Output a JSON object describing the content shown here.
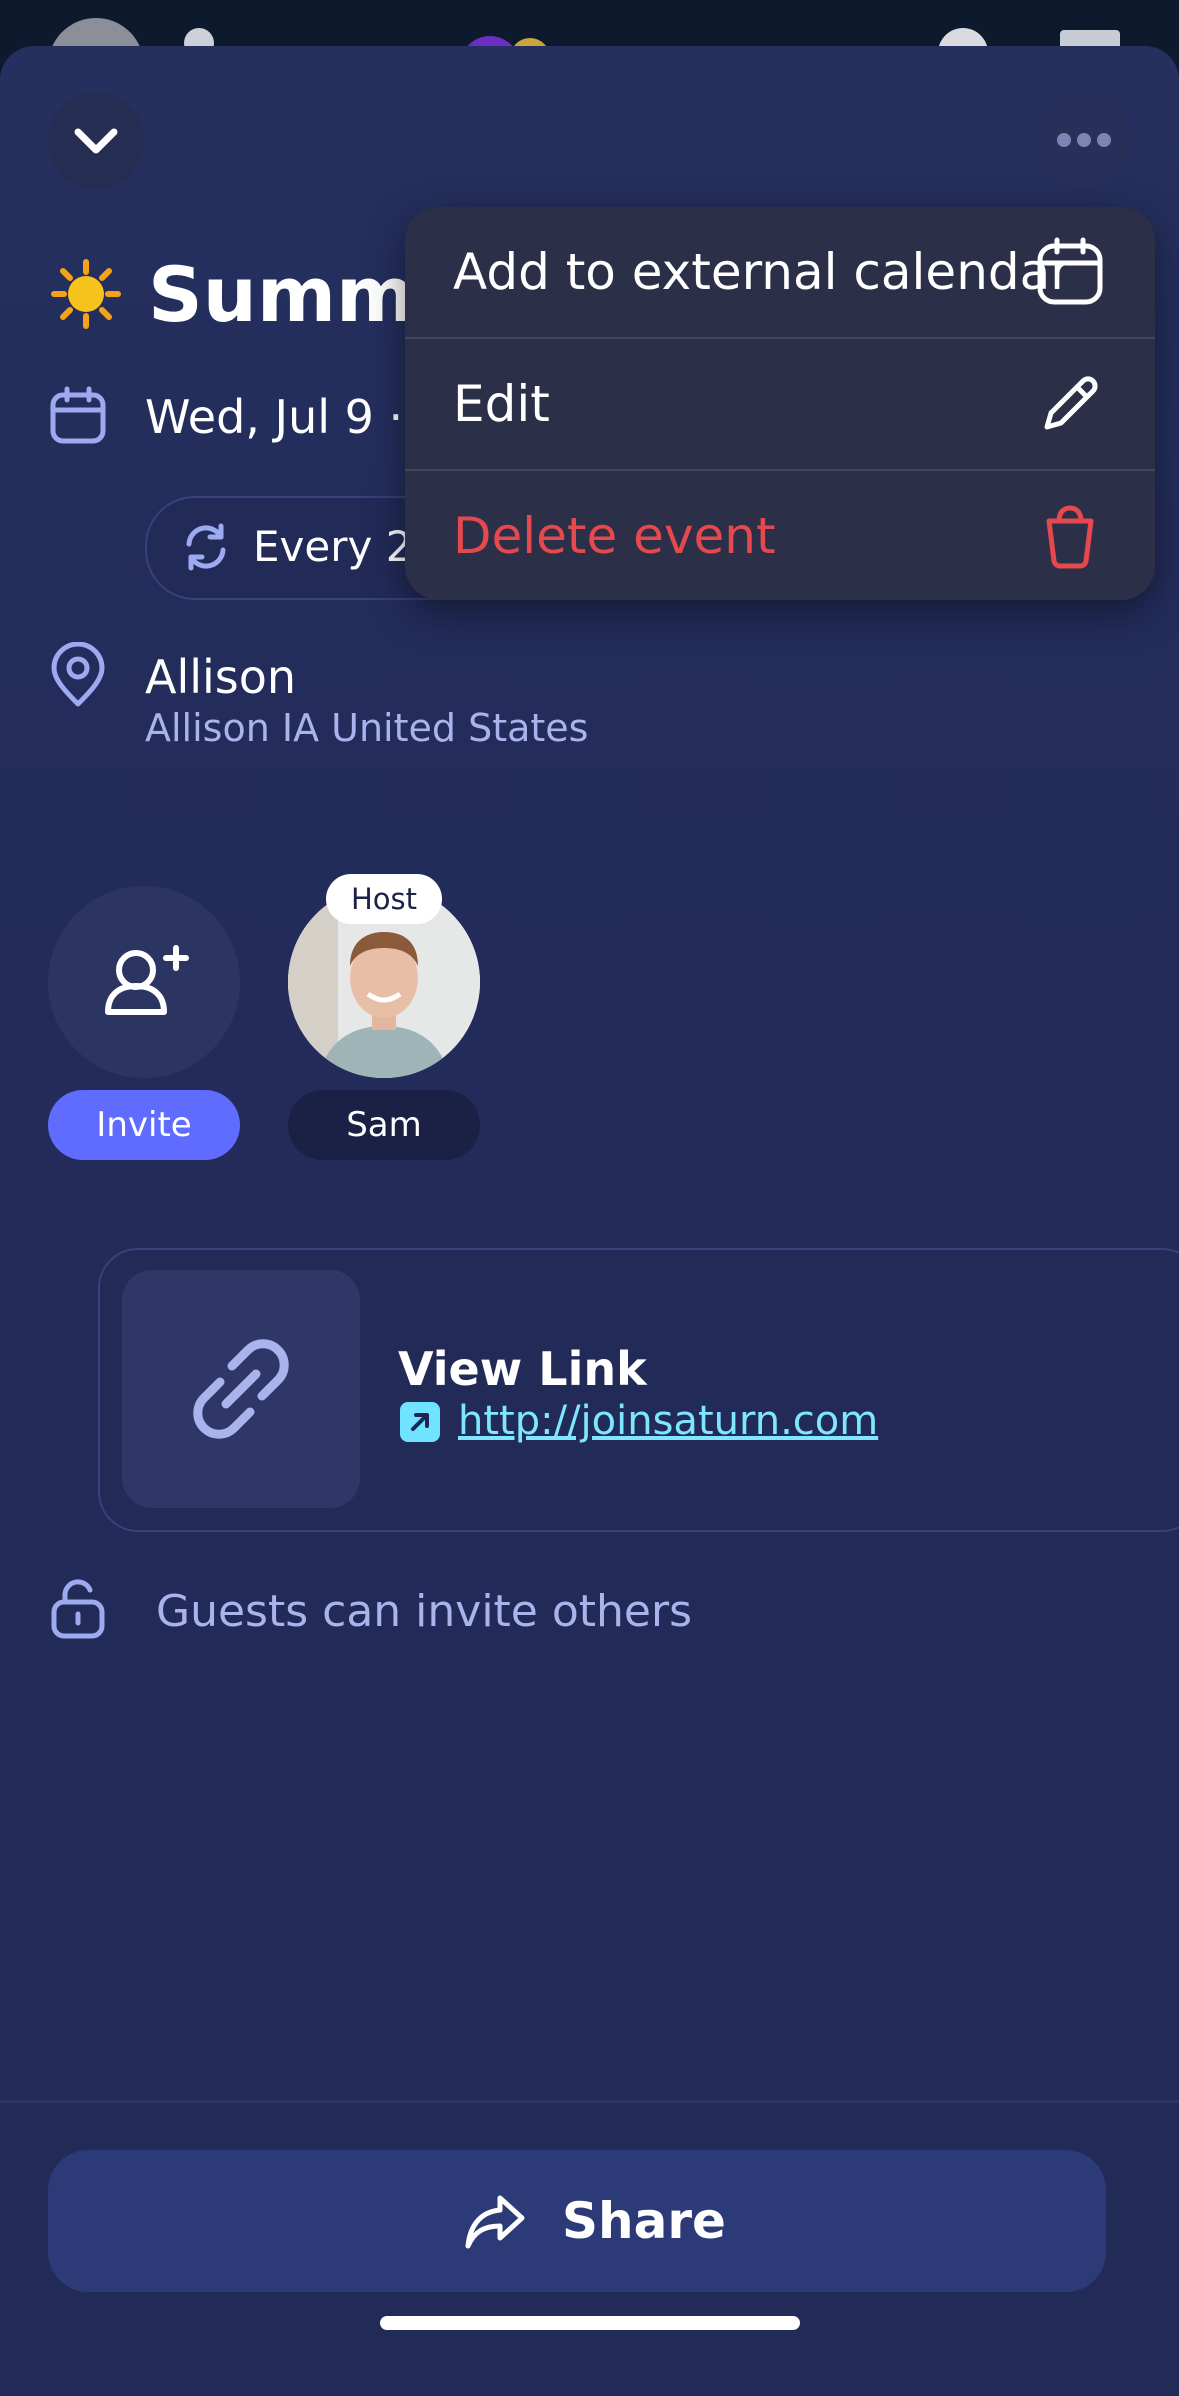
{
  "event": {
    "title": "Summe",
    "date": "Wed, Jul 9 ·",
    "repeat": "Every 2",
    "location_name": "Allison",
    "location_detail": "Allison IA United States"
  },
  "people": {
    "invite_label": "Invite",
    "host_badge": "Host",
    "host_name": "Sam"
  },
  "link": {
    "title": "View Link",
    "url": "http://joinsaturn.com"
  },
  "permissions": {
    "guests_text": "Guests can invite others"
  },
  "footer": {
    "share_label": "Share"
  },
  "menu": {
    "items": [
      {
        "label": "Add to external calendar",
        "icon": "calendar-icon"
      },
      {
        "label": "Edit",
        "icon": "pencil-icon"
      },
      {
        "label": "Delete event",
        "icon": "trash-icon"
      }
    ]
  },
  "colors": {
    "accent": "#5f6cff",
    "destructive": "#e5484d",
    "link": "#7fe6ff",
    "background": "#222a58"
  }
}
